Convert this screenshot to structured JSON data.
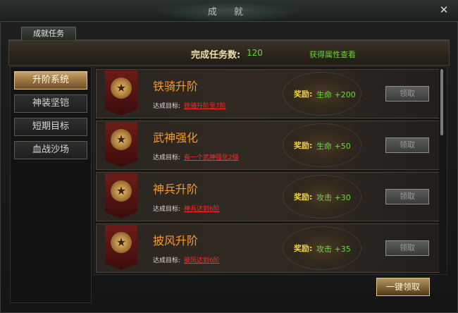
{
  "window": {
    "title": "成 就",
    "close_icon": "close-icon"
  },
  "tabs": [
    {
      "label": "成就任务"
    }
  ],
  "summary": {
    "label": "完成任务数:",
    "value": "120",
    "link": "获得属性查看"
  },
  "sidebar": {
    "items": [
      {
        "label": "升阶系统",
        "active": true
      },
      {
        "label": "神装坚铠",
        "active": false
      },
      {
        "label": "短期目标",
        "active": false
      },
      {
        "label": "血战沙场",
        "active": false
      }
    ]
  },
  "tasks": [
    {
      "title": "铁骑升阶",
      "goal_label": "达成目标:",
      "goal": "铁骑升阶至7阶",
      "reward_label": "奖励:",
      "reward": "生命 +200",
      "button": "领取",
      "icon": "star-medal-icon"
    },
    {
      "title": "武神强化",
      "goal_label": "达成目标:",
      "goal": "有一个武神强化2级",
      "reward_label": "奖励:",
      "reward": "生命 +50",
      "button": "领取",
      "icon": "star-medal-icon"
    },
    {
      "title": "神兵升阶",
      "goal_label": "达成目标:",
      "goal": "神兵达到6阶",
      "reward_label": "奖励:",
      "reward": "攻击 +30",
      "button": "领取",
      "icon": "star-medal-icon"
    },
    {
      "title": "披风升阶",
      "goal_label": "达成目标:",
      "goal": "披风达到6阶",
      "reward_label": "奖励:",
      "reward": "攻击 +35",
      "button": "领取",
      "icon": "star-medal-icon"
    }
  ],
  "claim_all": {
    "label": "一键领取"
  },
  "colors": {
    "accent_orange": "#f29a2e",
    "reward_green": "#6ad640",
    "goal_red": "#ff2b2b",
    "gold": "#e5c48b"
  }
}
